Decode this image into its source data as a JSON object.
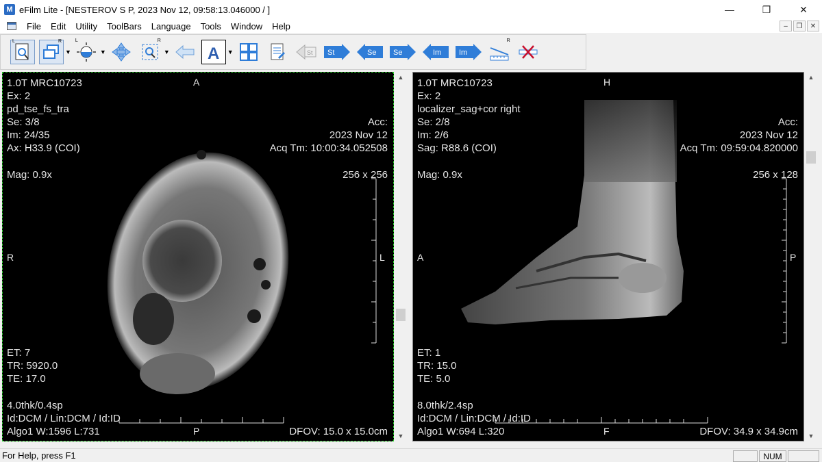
{
  "window": {
    "app_name": "eFilm Lite",
    "title": "eFilm Lite - [NESTEROV S P, 2023 Nov 12, 09:58:13.046000  /  ]",
    "minimize": "—",
    "maximize": "❐",
    "close": "✕"
  },
  "menu": {
    "items": [
      "File",
      "Edit",
      "Utility",
      "ToolBars",
      "Language",
      "Tools",
      "Window",
      "Help"
    ],
    "mdi_minimize": "–",
    "mdi_restore": "❐",
    "mdi_close": "✕"
  },
  "toolbar": {
    "series_next_label": "St",
    "series_prev_label": "Se",
    "series_next2_label": "Se",
    "image_prev_label": "Im",
    "image_next_label": "Im",
    "accent": "#2f7dd8"
  },
  "viewport1": {
    "institution": "1.0T MRC10723",
    "exam": "Ex: 2",
    "protocol": "pd_tse_fs_tra",
    "series": "Se: 3/8",
    "image": "Im: 24/35",
    "position": "Ax: H33.9 (COI)",
    "mag": "Mag: 0.9x",
    "acc": "Acc:",
    "date": "2023 Nov 12",
    "acq_time": "Acq Tm: 10:00:34.052508",
    "matrix": "256 x 256",
    "et": "ET: 7",
    "tr": "TR: 5920.0",
    "te": "TE: 17.0",
    "thickness": "4.0thk/0.4sp",
    "id_line": "Id:DCM / Lin:DCM / Id:ID",
    "window_level": "Algo1 W:1596  L:731",
    "dfov": "DFOV: 15.0 x 15.0cm",
    "orient_top": "A",
    "orient_left": "R",
    "orient_right": "L",
    "orient_bottom": "P"
  },
  "viewport2": {
    "institution": "1.0T MRC10723",
    "exam": "Ex: 2",
    "protocol": "localizer_sag+cor right",
    "series": "Se: 2/8",
    "image": "Im: 2/6",
    "position": "Sag: R88.6 (COI)",
    "mag": "Mag: 0.9x",
    "acc": "Acc:",
    "date": "2023 Nov 12",
    "acq_time": "Acq Tm: 09:59:04.820000",
    "matrix": "256 x 128",
    "et": "ET: 1",
    "tr": "TR: 15.0",
    "te": "TE: 5.0",
    "thickness": "8.0thk/2.4sp",
    "id_line": "Id:DCM / Lin:DCM / Id:ID",
    "window_level": "Algo1 W:694  L:320",
    "dfov": "DFOV: 34.9 x 34.9cm",
    "orient_top": "H",
    "orient_left": "A",
    "orient_right": "P",
    "orient_bottom": "F"
  },
  "status": {
    "help_text": "For Help, press F1",
    "num": "NUM"
  }
}
